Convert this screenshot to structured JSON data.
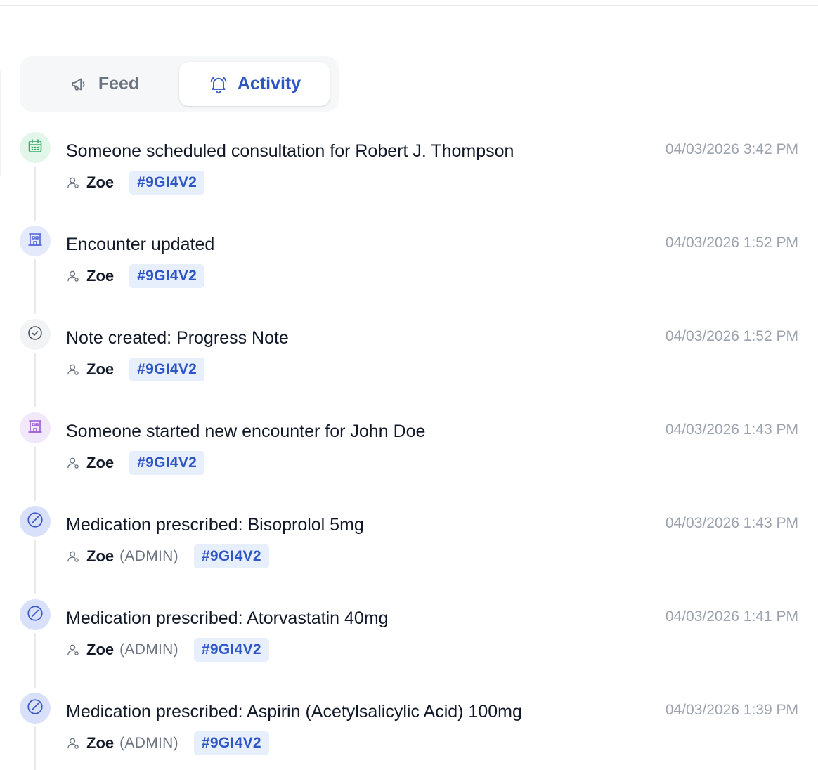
{
  "tabs": {
    "feed": {
      "label": "Feed",
      "icon": "megaphone-icon"
    },
    "activity": {
      "label": "Activity",
      "icon": "bell-ring-icon",
      "active": true
    }
  },
  "colors": {
    "accent": "#2d55c5",
    "tag_bg": "#e7eefc",
    "muted": "#9ca3af"
  },
  "activities": [
    {
      "title": "Someone scheduled consultation for Robert J. Thompson",
      "user": "Zoe",
      "role": "",
      "tag": "#9GI4V2",
      "time": "04/03/2026 3:42 PM",
      "icon": "calendar-icon",
      "icon_color": "#3fa968"
    },
    {
      "title": "Encounter updated",
      "user": "Zoe",
      "role": "",
      "tag": "#9GI4V2",
      "time": "04/03/2026 1:52 PM",
      "icon": "building-icon",
      "icon_color": "#4f63d9"
    },
    {
      "title": "Note created: Progress Note",
      "user": "Zoe",
      "role": "",
      "tag": "#9GI4V2",
      "time": "04/03/2026 1:52 PM",
      "icon": "check-circle-icon",
      "icon_color": "#4b5563"
    },
    {
      "title": "Someone started new encounter for John Doe",
      "user": "Zoe",
      "role": "",
      "tag": "#9GI4V2",
      "time": "04/03/2026 1:43 PM",
      "icon": "building-icon",
      "icon_color": "#9b59d6"
    },
    {
      "title": "Medication prescribed: Bisoprolol 5mg",
      "user": "Zoe",
      "role": "(ADMIN)",
      "tag": "#9GI4V2",
      "time": "04/03/2026 1:43 PM",
      "icon": "pill-icon",
      "icon_color": "#3d57c9"
    },
    {
      "title": "Medication prescribed: Atorvastatin 40mg",
      "user": "Zoe",
      "role": "(ADMIN)",
      "tag": "#9GI4V2",
      "time": "04/03/2026 1:41 PM",
      "icon": "pill-icon",
      "icon_color": "#3d57c9"
    },
    {
      "title": "Medication prescribed: Aspirin (Acetylsalicylic Acid) 100mg",
      "user": "Zoe",
      "role": "(ADMIN)",
      "tag": "#9GI4V2",
      "time": "04/03/2026 1:39 PM",
      "icon": "pill-icon",
      "icon_color": "#3d57c9"
    }
  ]
}
